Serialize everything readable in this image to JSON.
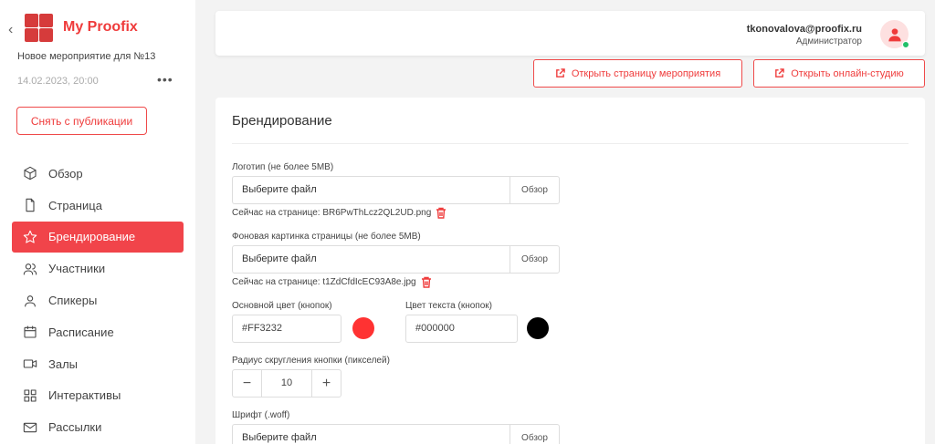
{
  "sidebar": {
    "brand": "My Proofix",
    "event_name": "Новое мероприятие для №13",
    "event_date": "14.02.2023, 20:00",
    "more": "•••",
    "unpublish_label": "Снять с публикации",
    "items": [
      {
        "label": "Обзор",
        "icon": "cube-icon"
      },
      {
        "label": "Страница",
        "icon": "file-icon"
      },
      {
        "label": "Брендирование",
        "icon": "star-icon",
        "active": true
      },
      {
        "label": "Участники",
        "icon": "users-icon"
      },
      {
        "label": "Спикеры",
        "icon": "user-icon"
      },
      {
        "label": "Расписание",
        "icon": "calendar-icon"
      },
      {
        "label": "Залы",
        "icon": "video-icon"
      },
      {
        "label": "Интерактивы",
        "icon": "grid-icon"
      },
      {
        "label": "Рассылки",
        "icon": "mail-icon"
      }
    ]
  },
  "header": {
    "email": "tkonovalova@proofix.ru",
    "role": "Администратор"
  },
  "actions": {
    "open_page": "Открыть страницу мероприятия",
    "open_studio": "Открыть онлайн-студию"
  },
  "branding": {
    "title": "Брендирование",
    "logo": {
      "label": "Логотип (не более 5MB)",
      "placeholder": "Выберите файл",
      "browse": "Обзор",
      "current": "Сейчас на странице: BR6PwThLcz2QL2UD.png"
    },
    "background": {
      "label": "Фоновая картинка страницы (не более 5MB)",
      "placeholder": "Выберите файл",
      "browse": "Обзор",
      "current": "Сейчас на странице: t1ZdCfdIcEC93A8e.jpg"
    },
    "primary_color": {
      "label": "Основной цвет (кнопок)",
      "value": "#FF3232",
      "swatch": "#FF3232"
    },
    "text_color": {
      "label": "Цвет текста (кнопок)",
      "value": "#000000",
      "swatch": "#000000"
    },
    "radius": {
      "label": "Радиус скругления кнопки (пикселей)",
      "value": "10",
      "minus": "−",
      "plus": "+"
    },
    "font": {
      "label": "Шрифт (.woff)",
      "placeholder": "Выберите файл",
      "browse": "Обзор"
    }
  },
  "colors": {
    "accent": "#EF3B3B",
    "online": "#21C06A"
  }
}
